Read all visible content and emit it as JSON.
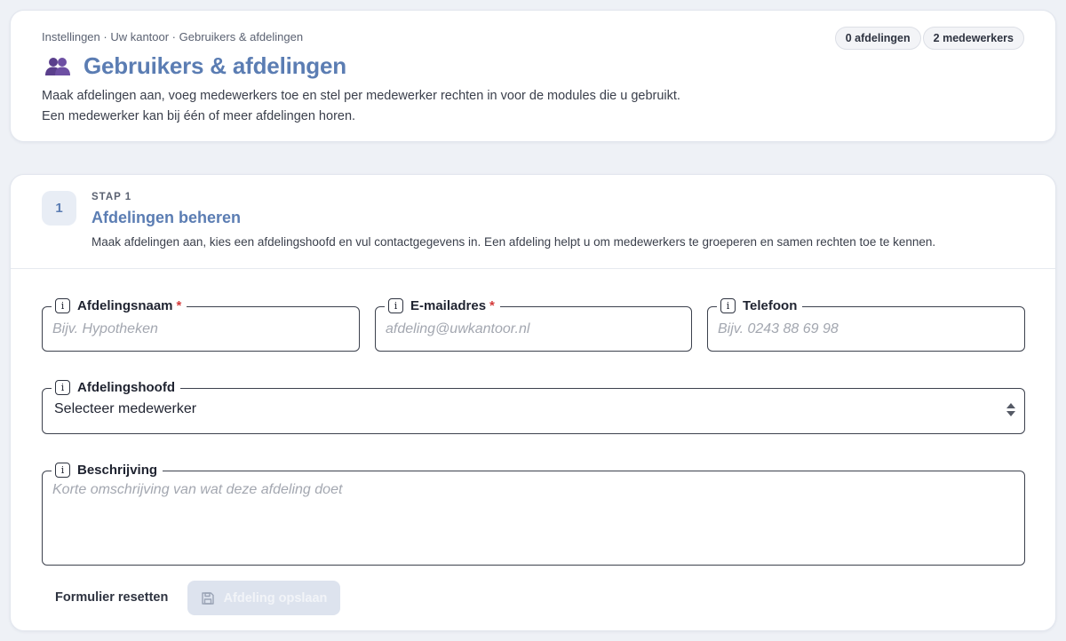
{
  "header": {
    "breadcrumb": "Instellingen · Uw kantoor · Gebruikers & afdelingen",
    "title": "Gebruikers & afdelingen",
    "title_icon": "users-icon",
    "description_line1": "Maak afdelingen aan, voeg medewerkers toe en stel per medewerker rechten in voor de modules die u gebruikt.",
    "description_line2": "Een medewerker kan bij één of meer afdelingen horen.",
    "badges": {
      "departments": "0 afdelingen",
      "employees": "2 medewerkers"
    }
  },
  "step": {
    "number": "1",
    "label": "STAP 1",
    "title": "Afdelingen beheren",
    "description": "Maak afdelingen aan, kies een afdelingshoofd en vul contactgegevens in. Een afdeling helpt u om medewerkers te groeperen en samen rechten toe te kennen."
  },
  "form": {
    "name": {
      "label": "Afdelingsnaam",
      "required_mark": "*",
      "placeholder": "Bijv. Hypotheken",
      "value": ""
    },
    "email": {
      "label": "E-mailadres",
      "required_mark": "*",
      "placeholder": "afdeling@uwkantoor.nl",
      "value": ""
    },
    "phone": {
      "label": "Telefoon",
      "placeholder": "Bijv. 0243 88 69 98",
      "value": ""
    },
    "head": {
      "label": "Afdelingshoofd",
      "selected": "Selecteer medewerker"
    },
    "description": {
      "label": "Beschrijving",
      "placeholder": "Korte omschrijving van wat deze afdeling doet",
      "value": ""
    },
    "info_icon_glyph": "i"
  },
  "actions": {
    "reset_label": "Formulier resetten",
    "save_label": "Afdeling opslaan",
    "save_icon": "save-icon"
  },
  "colors": {
    "accent": "#5b7db3",
    "required": "#d43a3a",
    "icon_purple": "#5a3f8c"
  }
}
